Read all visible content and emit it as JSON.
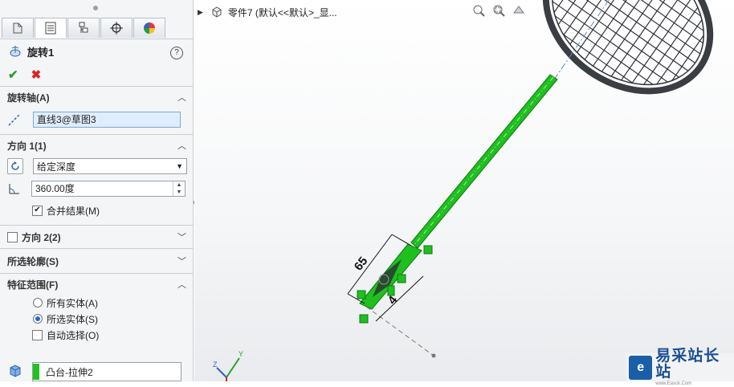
{
  "feature": {
    "title": "旋转1",
    "help_label": "?",
    "ok_label": "✔",
    "cancel_label": "✖"
  },
  "sections": {
    "axis": {
      "header": "旋转轴(A)",
      "value": "直线3@草图3"
    },
    "dir1": {
      "header": "方向 1(1)",
      "type": "给定深度",
      "angle": "360.00度",
      "merge_label": "合并结果(M)",
      "merge_checked": true
    },
    "dir2": {
      "header": "方向 2(2)",
      "checked": false
    },
    "contours": {
      "header": "所选轮廓(S)"
    },
    "scope": {
      "header": "特征范围(F)",
      "opt_all": "所有实体(A)",
      "opt_selected": "所选实体(S)",
      "auto_select": "自动选择(O)",
      "selected_body": "凸台-拉伸2"
    }
  },
  "viewport": {
    "breadcrumb": "零件7 (默认<<默认>_显...",
    "dim_65": "65",
    "dim_4": "4",
    "axis_y": "Y",
    "axis_z": "Z"
  },
  "watermark": {
    "text": "易采站长站",
    "subtext": "www.Easck.Com"
  },
  "colors": {
    "highlight_green": "#1fbf1f",
    "field_blue": "#dfeefc",
    "ok_green": "#2e9c2e",
    "cancel_red": "#dd2222"
  }
}
